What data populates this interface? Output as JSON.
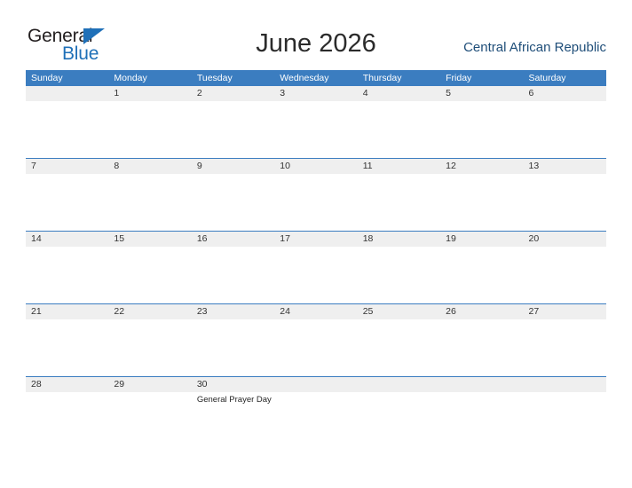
{
  "brand": {
    "name_part1": "General",
    "name_part2": "Blue",
    "logo_icon": "triangle-flag-icon",
    "color_dark": "#231f20",
    "color_blue": "#1f70b8"
  },
  "header": {
    "title": "June 2026",
    "region": "Central African Republic"
  },
  "calendar": {
    "month": "June",
    "year": "2026",
    "accent_color": "#3b7dc0",
    "band_color": "#efefef",
    "weekdays": [
      "Sunday",
      "Monday",
      "Tuesday",
      "Wednesday",
      "Thursday",
      "Friday",
      "Saturday"
    ],
    "weeks": [
      [
        {
          "day": "",
          "events": []
        },
        {
          "day": "1",
          "events": []
        },
        {
          "day": "2",
          "events": []
        },
        {
          "day": "3",
          "events": []
        },
        {
          "day": "4",
          "events": []
        },
        {
          "day": "5",
          "events": []
        },
        {
          "day": "6",
          "events": []
        }
      ],
      [
        {
          "day": "7",
          "events": []
        },
        {
          "day": "8",
          "events": []
        },
        {
          "day": "9",
          "events": []
        },
        {
          "day": "10",
          "events": []
        },
        {
          "day": "11",
          "events": []
        },
        {
          "day": "12",
          "events": []
        },
        {
          "day": "13",
          "events": []
        }
      ],
      [
        {
          "day": "14",
          "events": []
        },
        {
          "day": "15",
          "events": []
        },
        {
          "day": "16",
          "events": []
        },
        {
          "day": "17",
          "events": []
        },
        {
          "day": "18",
          "events": []
        },
        {
          "day": "19",
          "events": []
        },
        {
          "day": "20",
          "events": []
        }
      ],
      [
        {
          "day": "21",
          "events": []
        },
        {
          "day": "22",
          "events": []
        },
        {
          "day": "23",
          "events": []
        },
        {
          "day": "24",
          "events": []
        },
        {
          "day": "25",
          "events": []
        },
        {
          "day": "26",
          "events": []
        },
        {
          "day": "27",
          "events": []
        }
      ],
      [
        {
          "day": "28",
          "events": []
        },
        {
          "day": "29",
          "events": []
        },
        {
          "day": "30",
          "events": [
            "General Prayer Day"
          ]
        },
        {
          "day": "",
          "events": []
        },
        {
          "day": "",
          "events": []
        },
        {
          "day": "",
          "events": []
        },
        {
          "day": "",
          "events": []
        }
      ]
    ]
  }
}
